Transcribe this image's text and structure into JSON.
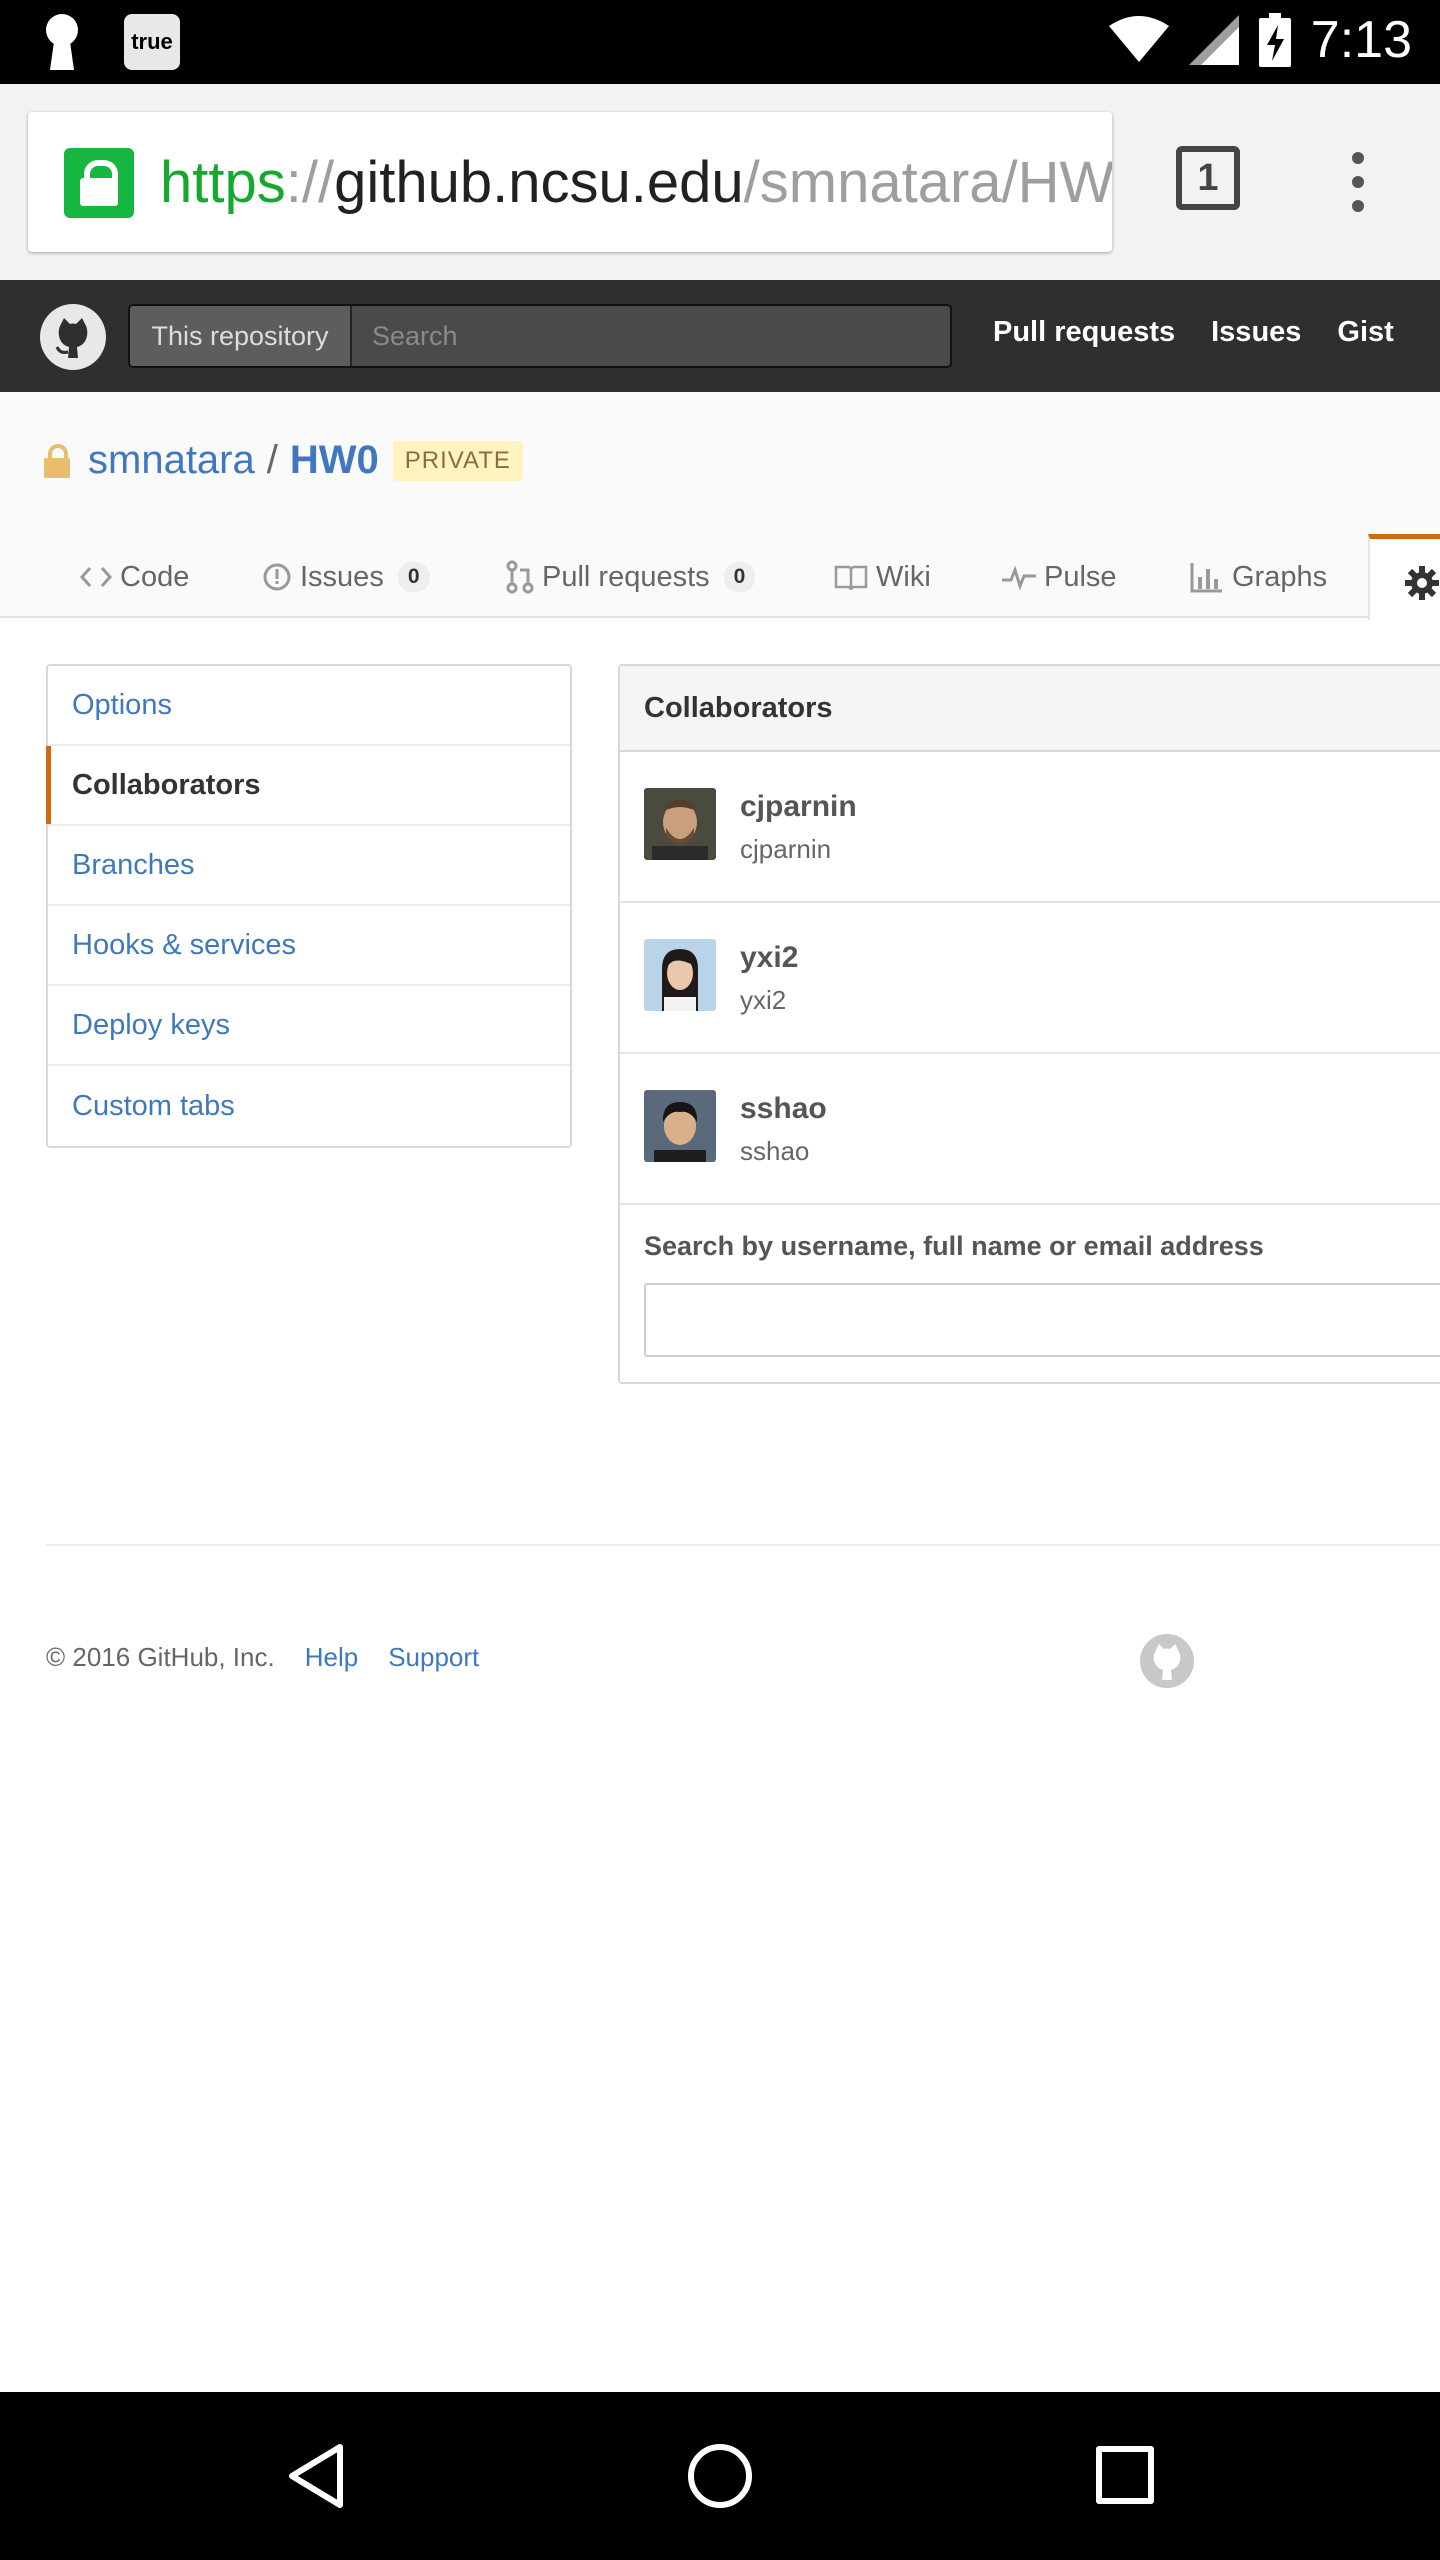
{
  "status_bar": {
    "time": "7:13",
    "app_badge": "true"
  },
  "browser": {
    "url_scheme": "https",
    "url_separator": "://",
    "url_host": "github.ncsu.edu",
    "url_path": "/smnatara/HW",
    "tab_count": "1"
  },
  "header": {
    "search_scope": "This repository",
    "search_placeholder": "Search",
    "nav": [
      "Pull requests",
      "Issues",
      "Gist"
    ]
  },
  "repo": {
    "owner": "smnatara",
    "separator": "/",
    "name": "HW0",
    "visibility": "PRIVATE",
    "tabs": [
      {
        "label": "Code",
        "icon": "code-icon"
      },
      {
        "label": "Issues",
        "icon": "issue-icon",
        "count": "0"
      },
      {
        "label": "Pull requests",
        "icon": "pull-request-icon",
        "count": "0"
      },
      {
        "label": "Wiki",
        "icon": "book-icon"
      },
      {
        "label": "Pulse",
        "icon": "pulse-icon"
      },
      {
        "label": "Graphs",
        "icon": "graph-icon"
      }
    ],
    "settings_tab_icon": "gear-icon"
  },
  "settings_menu": {
    "items": [
      "Options",
      "Collaborators",
      "Branches",
      "Hooks & services",
      "Deploy keys",
      "Custom tabs"
    ],
    "selected": "Collaborators"
  },
  "collaborators": {
    "title": "Collaborators",
    "people": [
      {
        "name": "cjparnin",
        "login": "cjparnin"
      },
      {
        "name": "yxi2",
        "login": "yxi2"
      },
      {
        "name": "sshao",
        "login": "sshao"
      }
    ],
    "search_label": "Search by username, full name or email address",
    "search_value": ""
  },
  "footer": {
    "copyright": "© 2016 GitHub, Inc.",
    "links": [
      "Help",
      "Support"
    ]
  },
  "colors": {
    "accent": "#d26911",
    "link": "#4078c0",
    "header_bg": "#2f2f2f",
    "secure_green": "#16b640"
  }
}
